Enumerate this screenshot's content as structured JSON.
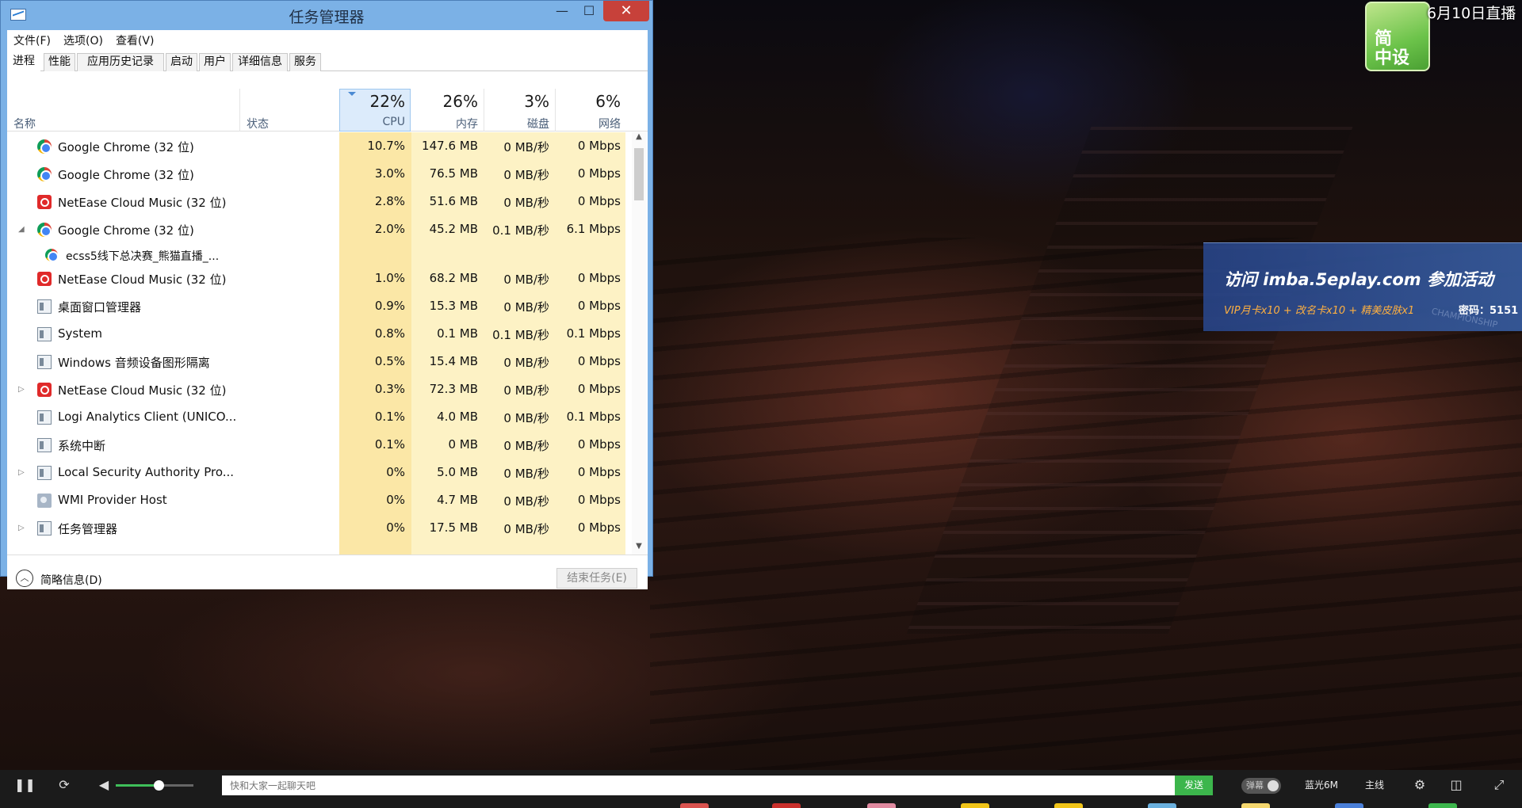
{
  "window": {
    "title": "任务管理器",
    "controls": {
      "minimize": "—",
      "maximize": "☐",
      "close": "✕"
    }
  },
  "menu": [
    "文件(F)",
    "选项(O)",
    "查看(V)"
  ],
  "tabs": [
    "进程",
    "性能",
    "应用历史记录",
    "启动",
    "用户",
    "详细信息",
    "服务"
  ],
  "active_tab": "进程",
  "columns": {
    "name": "名称",
    "status": "状态",
    "cpu": {
      "pct": "22%",
      "label": "CPU"
    },
    "memory": {
      "pct": "26%",
      "label": "内存"
    },
    "disk": {
      "pct": "3%",
      "label": "磁盘"
    },
    "network": {
      "pct": "6%",
      "label": "网络"
    }
  },
  "processes": [
    {
      "name": "Google Chrome (32 位)",
      "icon": "chrome",
      "expander": "",
      "cpu": "10.7%",
      "mem": "147.6 MB",
      "disk": "0 MB/秒",
      "net": "0 Mbps"
    },
    {
      "name": "Google Chrome (32 位)",
      "icon": "chrome",
      "expander": "",
      "cpu": "3.0%",
      "mem": "76.5 MB",
      "disk": "0 MB/秒",
      "net": "0 Mbps"
    },
    {
      "name": "NetEase Cloud Music (32 位)",
      "icon": "netease",
      "expander": "",
      "cpu": "2.8%",
      "mem": "51.6 MB",
      "disk": "0 MB/秒",
      "net": "0 Mbps"
    },
    {
      "name": "Google Chrome (32 位)",
      "icon": "chrome",
      "expander": "◢",
      "cpu": "2.0%",
      "mem": "45.2 MB",
      "disk": "0.1 MB/秒",
      "net": "6.1 Mbps"
    },
    {
      "name": "ecss5线下总决赛_熊猫直播_...",
      "icon": "chrome",
      "child": true,
      "cpu": "",
      "mem": "",
      "disk": "",
      "net": ""
    },
    {
      "name": "NetEase Cloud Music (32 位)",
      "icon": "netease",
      "expander": "",
      "cpu": "1.0%",
      "mem": "68.2 MB",
      "disk": "0 MB/秒",
      "net": "0 Mbps"
    },
    {
      "name": "桌面窗口管理器",
      "icon": "system",
      "expander": "",
      "cpu": "0.9%",
      "mem": "15.3 MB",
      "disk": "0 MB/秒",
      "net": "0 Mbps"
    },
    {
      "name": "System",
      "icon": "system",
      "expander": "",
      "cpu": "0.8%",
      "mem": "0.1 MB",
      "disk": "0.1 MB/秒",
      "net": "0.1 Mbps"
    },
    {
      "name": "Windows 音频设备图形隔离",
      "icon": "system",
      "expander": "",
      "cpu": "0.5%",
      "mem": "15.4 MB",
      "disk": "0 MB/秒",
      "net": "0 Mbps"
    },
    {
      "name": "NetEase Cloud Music (32 位)",
      "icon": "netease",
      "expander": "▷",
      "cpu": "0.3%",
      "mem": "72.3 MB",
      "disk": "0 MB/秒",
      "net": "0 Mbps"
    },
    {
      "name": "Logi Analytics Client (UNICO...",
      "icon": "system",
      "expander": "",
      "cpu": "0.1%",
      "mem": "4.0 MB",
      "disk": "0 MB/秒",
      "net": "0.1 Mbps"
    },
    {
      "name": "系统中断",
      "icon": "system",
      "expander": "",
      "cpu": "0.1%",
      "mem": "0 MB",
      "disk": "0 MB/秒",
      "net": "0 Mbps"
    },
    {
      "name": "Local Security Authority Pro...",
      "icon": "system",
      "expander": "▷",
      "cpu": "0%",
      "mem": "5.0 MB",
      "disk": "0 MB/秒",
      "net": "0 Mbps"
    },
    {
      "name": "WMI Provider Host",
      "icon": "wmi",
      "expander": "",
      "cpu": "0%",
      "mem": "4.7 MB",
      "disk": "0 MB/秒",
      "net": "0 Mbps"
    },
    {
      "name": "任务管理器",
      "icon": "system",
      "expander": "▷",
      "cpu": "0%",
      "mem": "17.5 MB",
      "disk": "0 MB/秒",
      "net": "0 Mbps"
    }
  ],
  "footer": {
    "fewer_details": "简略信息(D)",
    "end_task": "结束任务(E)"
  },
  "stream": {
    "logo_text": "简\n中设",
    "date_label": "6月10日直播",
    "promo_main": "访问 imba.5eplay.com 参加活动",
    "promo_sub": "VIP月卡x10 + 改名卡x10 + 精美皮肤x1",
    "promo_pass": "密码：5151",
    "promo_watermark": "CHAMPIONSHIP"
  },
  "player": {
    "volume": 0.55,
    "chat_placeholder": "快和大家一起聊天吧",
    "send_label": "发送",
    "danmu_label": "弹幕",
    "quality_label": "蓝光6M",
    "line_label": "主线"
  },
  "colors": {
    "cpu_highlight": "#fbe7a6",
    "data_column": "#fdf2c5",
    "send_button": "#3cb64c",
    "close_button": "#c7413a"
  }
}
